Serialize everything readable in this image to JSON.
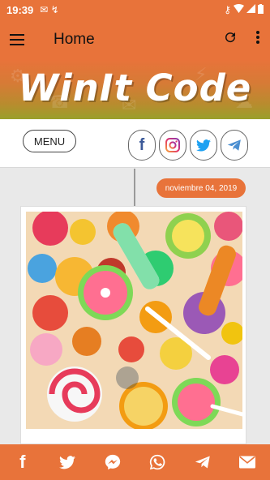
{
  "status_bar": {
    "time": "19:39",
    "left_icons": [
      "mail-icon",
      "n-icon"
    ],
    "right_icons": [
      "key-icon",
      "wifi-icon",
      "signal-icon",
      "battery-icon"
    ]
  },
  "app_bar": {
    "title": "Home",
    "actions": [
      "refresh-icon",
      "more-vert-icon"
    ]
  },
  "banner": {
    "logo": "WinIt Code"
  },
  "toolbar": {
    "menu_label": "MENU",
    "socials": [
      "facebook-icon",
      "instagram-icon",
      "twitter-icon",
      "telegram-icon"
    ]
  },
  "post": {
    "date": "noviembre 04, 2019"
  },
  "share_bar": {
    "items": [
      "facebook-icon",
      "twitter-icon",
      "messenger-icon",
      "whatsapp-icon",
      "telegram-icon",
      "email-icon"
    ]
  },
  "colors": {
    "accent": "#e8733a",
    "background": "#e9e9e9"
  }
}
